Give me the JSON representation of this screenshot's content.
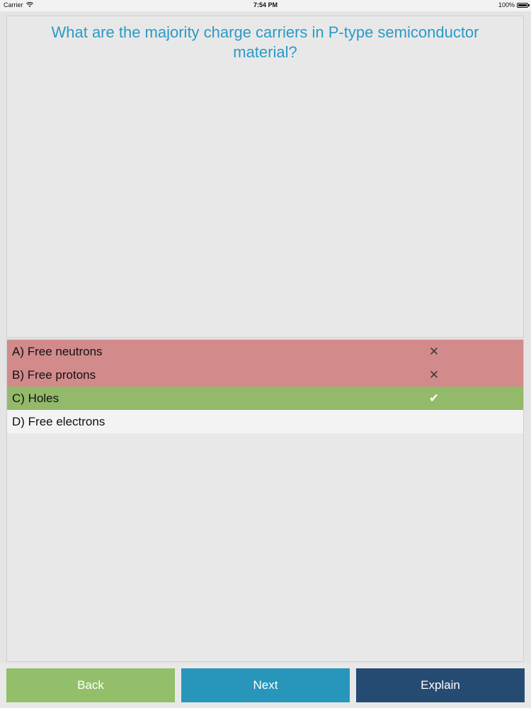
{
  "status_bar": {
    "carrier": "Carrier",
    "time": "7:54 PM",
    "battery": "100%"
  },
  "question": {
    "text": "What are the majority charge carriers in P-type semiconductor material?"
  },
  "answers": [
    {
      "label": "A) Free neutrons",
      "state": "wrong",
      "mark_icon": "cross-icon",
      "mark": "✕"
    },
    {
      "label": "B) Free protons",
      "state": "wrong",
      "mark_icon": "cross-icon",
      "mark": "✕"
    },
    {
      "label": "C) Holes",
      "state": "correct",
      "mark_icon": "check-icon",
      "mark": "✔"
    },
    {
      "label": "D) Free electrons",
      "state": "neutral",
      "mark_icon": "",
      "mark": ""
    }
  ],
  "buttons": {
    "back": "Back",
    "next": "Next",
    "explain": "Explain"
  },
  "colors": {
    "question_text": "#2a9ac7",
    "wrong": "#d28a8a",
    "correct": "#93b96a",
    "neutral": "#f3f3f3",
    "back": "#93bf6a",
    "next": "#2896bb",
    "explain": "#264b72"
  }
}
